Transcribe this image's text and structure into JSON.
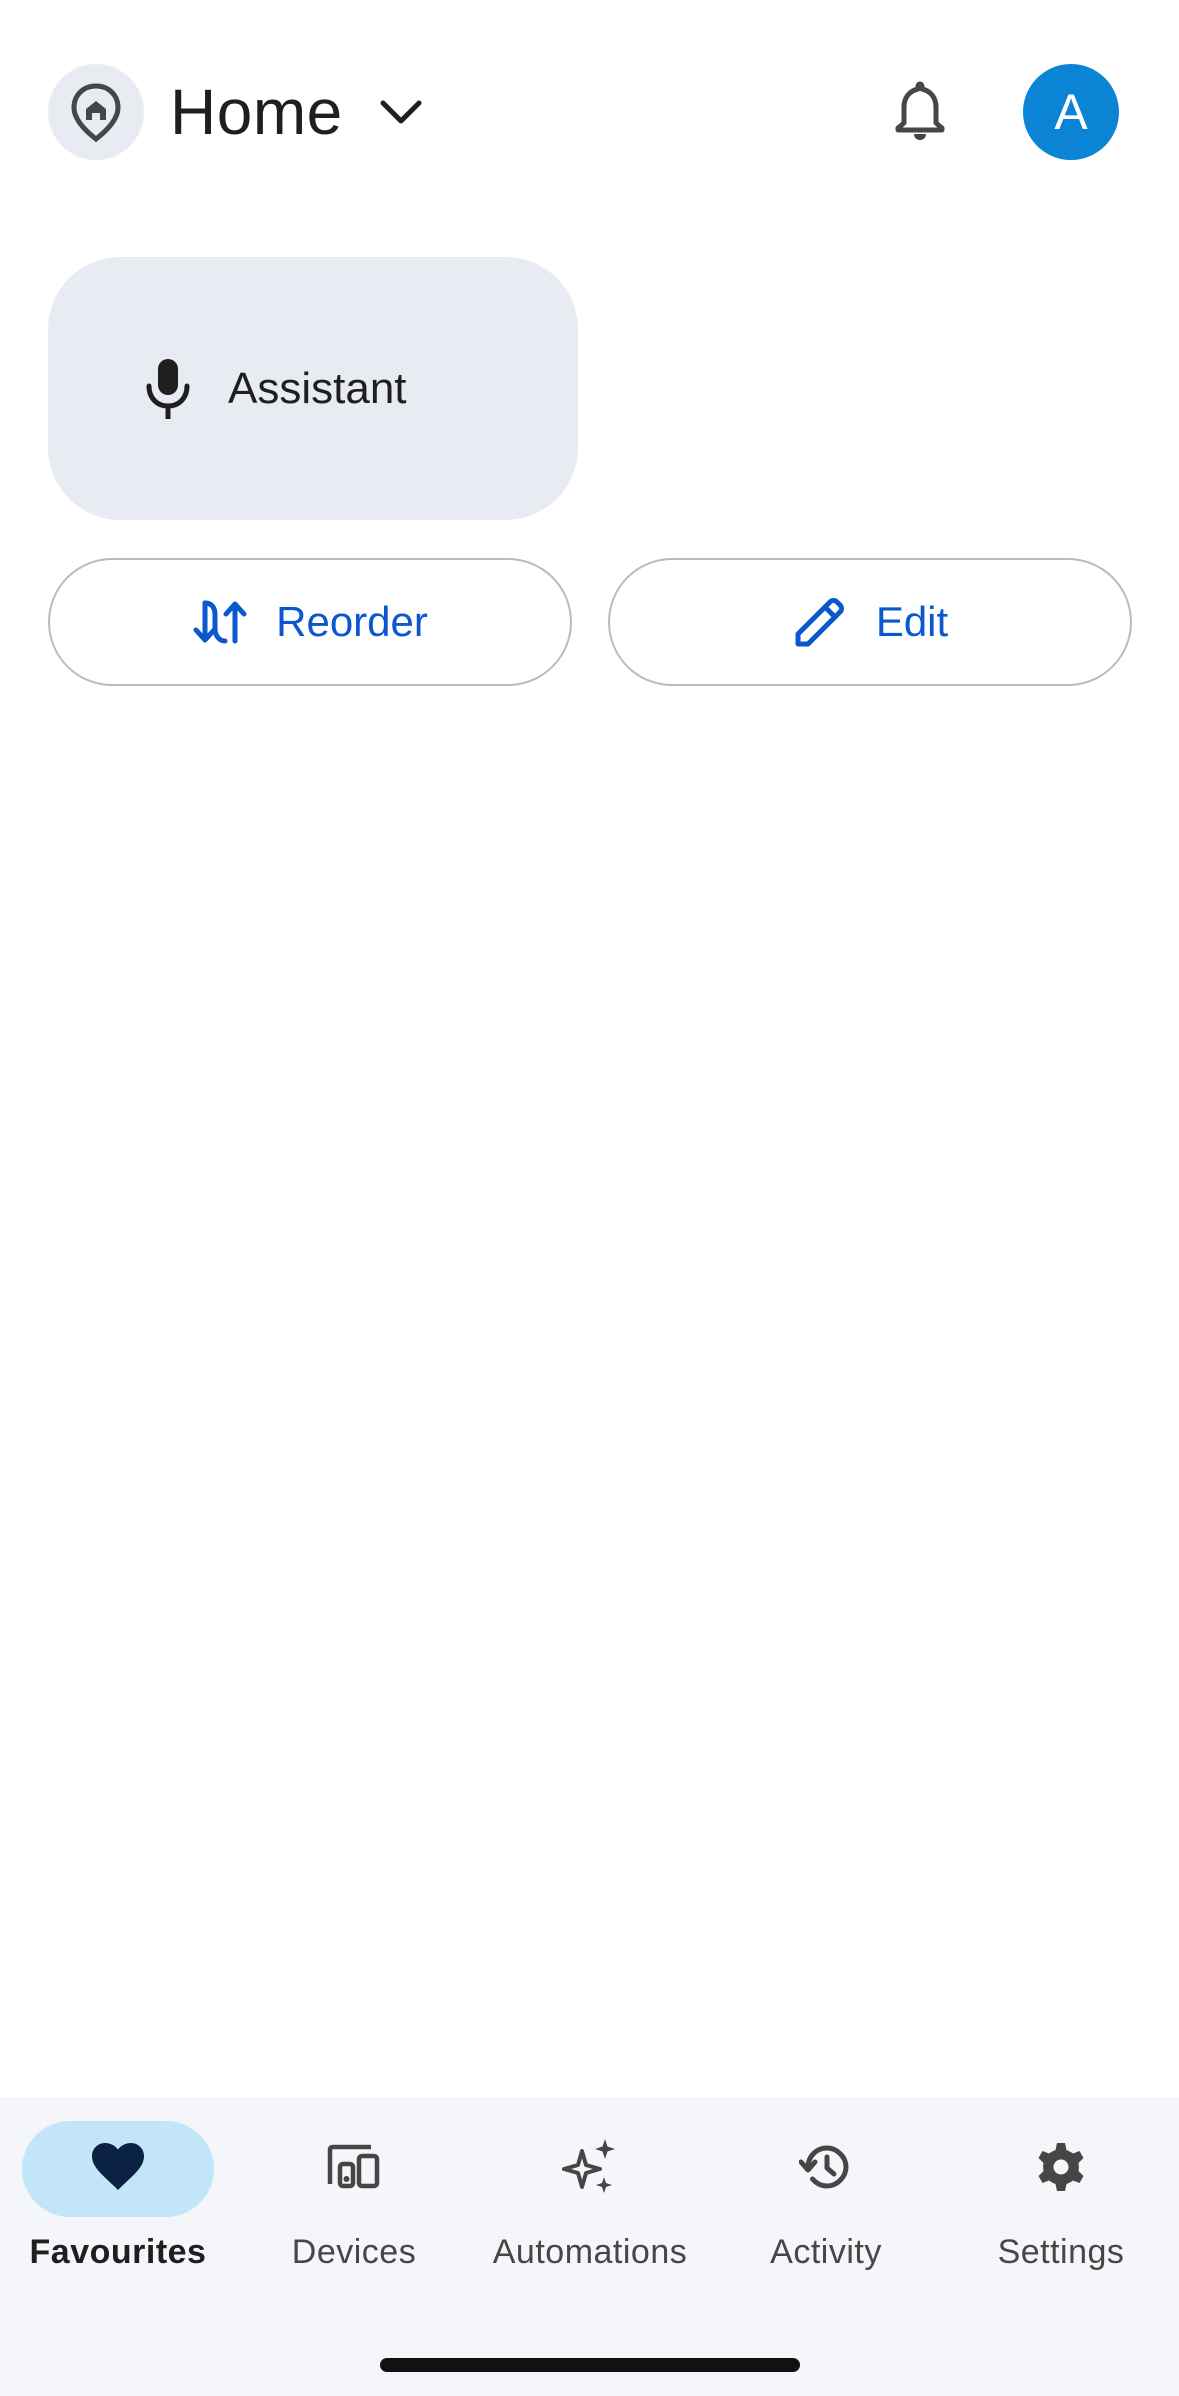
{
  "header": {
    "home_name": "Home",
    "avatar_initial": "A",
    "icons": {
      "home_location": "home-location-pin-icon",
      "dropdown": "chevron-down-icon",
      "notifications": "bell-icon"
    }
  },
  "assistant": {
    "label": "Assistant",
    "icon": "microphone-icon"
  },
  "actions": {
    "reorder_label": "Reorder",
    "reorder_icon": "reorder-arrows-icon",
    "edit_label": "Edit",
    "edit_icon": "pencil-icon"
  },
  "bottom_nav": {
    "items": [
      {
        "label": "Favourites",
        "icon": "heart-icon",
        "active": true
      },
      {
        "label": "Devices",
        "icon": "devices-icon",
        "active": false
      },
      {
        "label": "Automations",
        "icon": "sparkle-icon",
        "active": false
      },
      {
        "label": "Activity",
        "icon": "history-icon",
        "active": false
      },
      {
        "label": "Settings",
        "icon": "gear-icon",
        "active": false
      }
    ]
  },
  "colors": {
    "accent": "#0b57d0",
    "avatar_bg": "#0b84d6",
    "tile_bg": "#e8ecf2",
    "active_nav_bg": "#c3e5fa",
    "nav_bg": "#f4f6f9"
  }
}
